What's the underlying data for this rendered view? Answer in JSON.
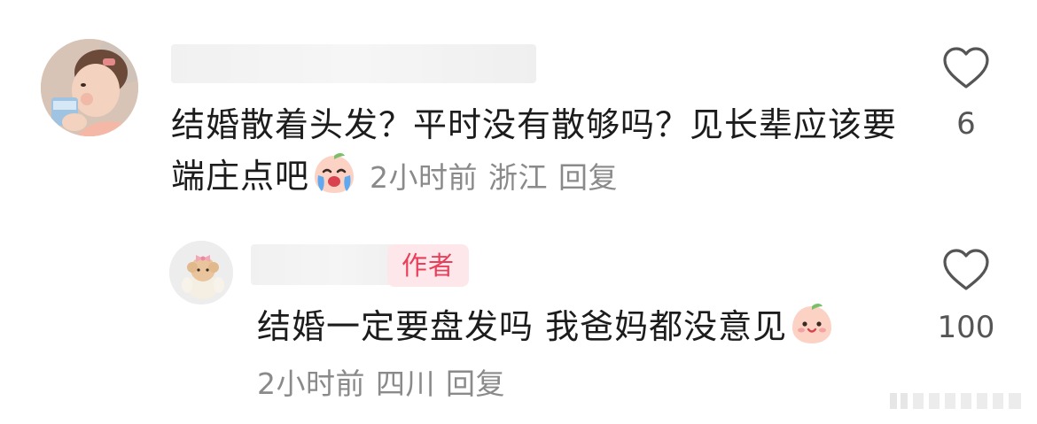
{
  "comment": {
    "text": "结婚散着头发？平时没有散够吗？见长辈应该要端庄点吧",
    "emoji": "crying-peach-emoji",
    "time": "2小时前",
    "location": "浙江",
    "reply_label": "回复",
    "likes": "6"
  },
  "reply": {
    "author_badge": "作者",
    "text": "结婚一定要盘发吗 我爸妈都没意见",
    "emoji": "smiling-peach-emoji",
    "time": "2小时前",
    "location": "四川",
    "reply_label": "回复",
    "likes": "100"
  },
  "colors": {
    "text_primary": "#1c1c1c",
    "text_meta": "#8a8a8a",
    "author_badge_bg": "#fde7ea",
    "author_badge_text": "#e8405a",
    "heart_outline": "#555555"
  },
  "icons": {
    "like": "heart-outline-icon"
  }
}
